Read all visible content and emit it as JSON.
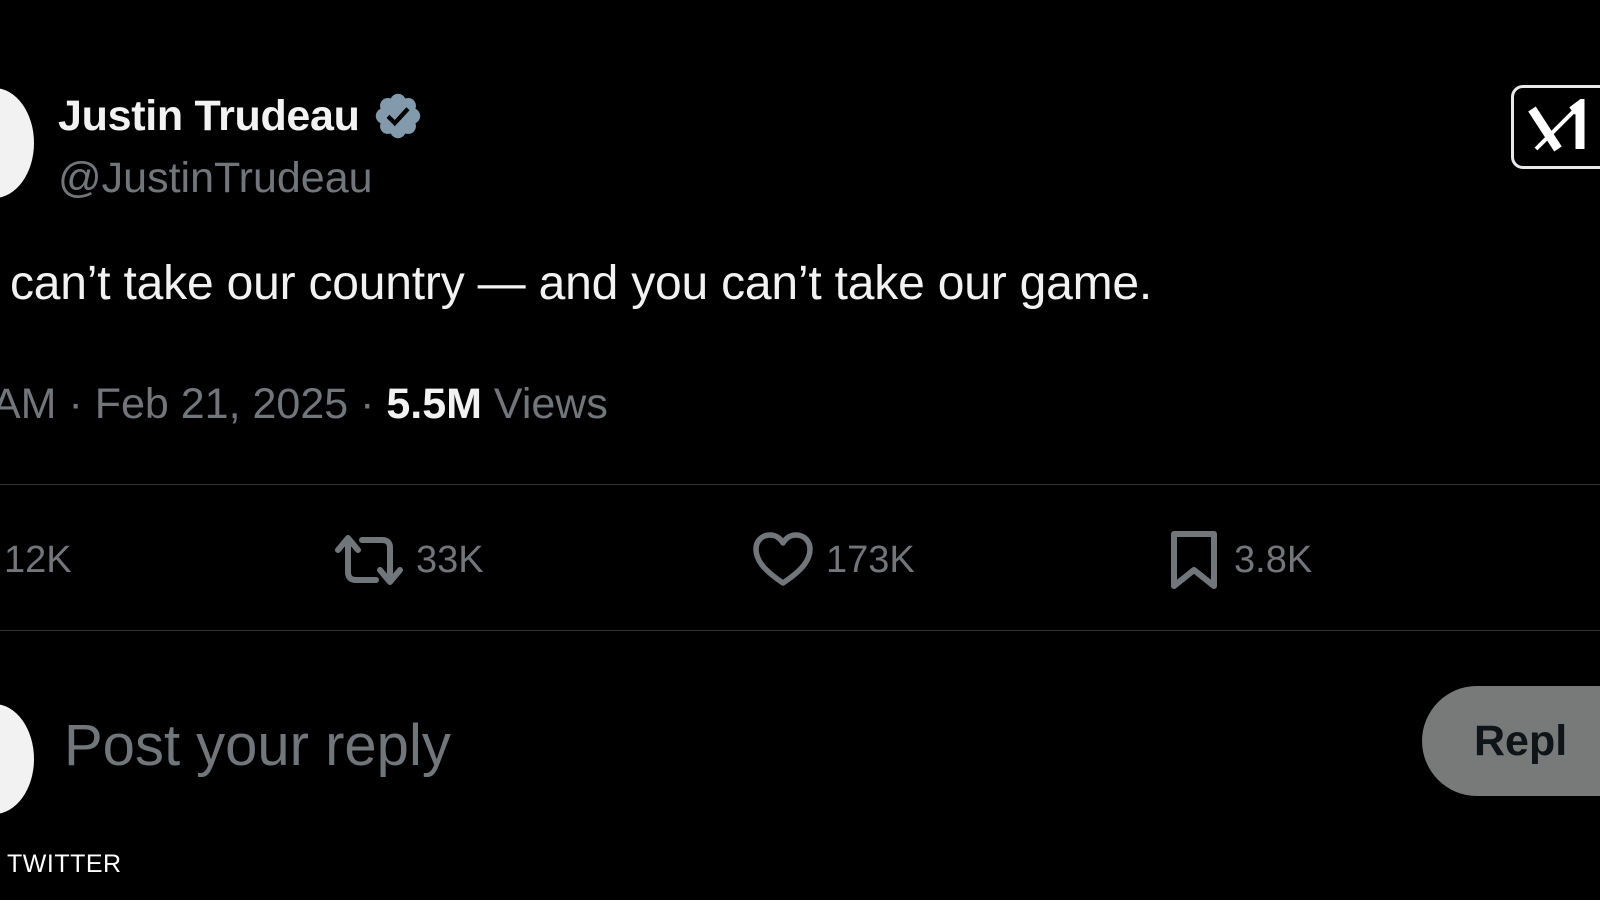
{
  "author": {
    "name": "Justin Trudeau",
    "handle": "@JustinTrudeau",
    "verified_icon": "verified-badge-icon"
  },
  "tweet": {
    "text": "can’t take our country — and you can’t take our game.",
    "time_prefix": "AM · ",
    "date": "Feb 21, 2025",
    "separator": " · ",
    "views_count": "5.5M",
    "views_label": " Views"
  },
  "actions": {
    "replies": "12K",
    "reposts": "33K",
    "likes": "173K",
    "bookmarks": "3.8K"
  },
  "reply_box": {
    "placeholder": "Post your reply",
    "button_label": "Repl"
  },
  "watermark": "TWITTER",
  "colors": {
    "background": "#000000",
    "text_primary": "#e7e9ea",
    "text_secondary": "#71767b",
    "divider": "#2f3336",
    "verified_badge": "#829aab",
    "reply_button": "#787a7a"
  }
}
